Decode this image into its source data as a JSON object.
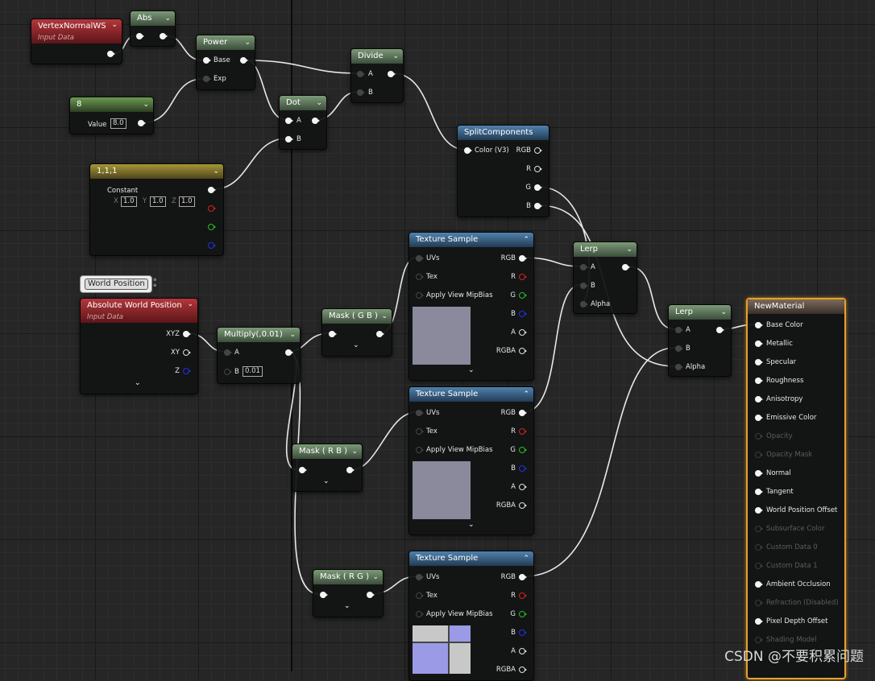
{
  "nodes": {
    "vertex_normal": {
      "title": "VertexNormalWS",
      "subtitle": "Input Data"
    },
    "abs": {
      "title": "Abs"
    },
    "power": {
      "title": "Power",
      "pin_base": "Base",
      "pin_exp": "Exp"
    },
    "const8": {
      "title": "8",
      "value_label": "Value",
      "value": "8.0"
    },
    "dot": {
      "title": "Dot",
      "pin_a": "A",
      "pin_b": "B"
    },
    "divide": {
      "title": "Divide",
      "pin_a": "A",
      "pin_b": "B"
    },
    "const111": {
      "title": "1,1,1",
      "constant_label": "Constant",
      "x_label": "X",
      "x_value": "1.0",
      "y_label": "Y",
      "y_value": "1.0",
      "z_label": "Z",
      "z_value": "1.0"
    },
    "split": {
      "title": "SplitComponents",
      "in_label": "Color (V3)",
      "out_rgb": "RGB",
      "out_r": "R",
      "out_g": "G",
      "out_b": "B"
    },
    "world_position_tag": {
      "label": "World Position"
    },
    "abs_world_pos": {
      "title": "Absolute World Position",
      "subtitle": "Input Data",
      "out_xyz": "XYZ",
      "out_xy": "XY",
      "out_z": "Z"
    },
    "multiply": {
      "title": "Multiply(,0.01)",
      "pin_a": "A",
      "pin_b": "B",
      "b_value": "0.01"
    },
    "mask_gb": {
      "title": "Mask ( G B )"
    },
    "mask_rb": {
      "title": "Mask ( R B )"
    },
    "mask_rg": {
      "title": "Mask ( R G )"
    },
    "texture_sample": {
      "title": "Texture Sample",
      "uvs": "UVs",
      "tex": "Tex",
      "mip": "Apply View MipBias",
      "rgb": "RGB",
      "r": "R",
      "g": "G",
      "b": "B",
      "a": "A",
      "rgba": "RGBA"
    },
    "lerp1": {
      "title": "Lerp",
      "pin_a": "A",
      "pin_b": "B",
      "pin_alpha": "Alpha"
    },
    "lerp2": {
      "title": "Lerp",
      "pin_a": "A",
      "pin_b": "B",
      "pin_alpha": "Alpha"
    },
    "material": {
      "title": "NewMaterial",
      "pins": [
        {
          "label": "Base Color",
          "enabled": true
        },
        {
          "label": "Metallic",
          "enabled": true
        },
        {
          "label": "Specular",
          "enabled": true
        },
        {
          "label": "Roughness",
          "enabled": true
        },
        {
          "label": "Anisotropy",
          "enabled": true
        },
        {
          "label": "Emissive Color",
          "enabled": true
        },
        {
          "label": "Opacity",
          "enabled": false
        },
        {
          "label": "Opacity Mask",
          "enabled": false
        },
        {
          "label": "Normal",
          "enabled": true
        },
        {
          "label": "Tangent",
          "enabled": true
        },
        {
          "label": "World Position Offset",
          "enabled": true
        },
        {
          "label": "Subsurface Color",
          "enabled": false
        },
        {
          "label": "Custom Data 0",
          "enabled": false
        },
        {
          "label": "Custom Data 1",
          "enabled": false
        },
        {
          "label": "Ambient Occlusion",
          "enabled": true
        },
        {
          "label": "Refraction (Disabled)",
          "enabled": false
        },
        {
          "label": "Pixel Depth Offset",
          "enabled": true
        },
        {
          "label": "Shading Model",
          "enabled": false
        }
      ]
    }
  },
  "watermark": "CSDN @不要积累问题",
  "colors": {
    "selection": "#e6a12c",
    "wire": "#e8e8e8",
    "preview_flat": "#8a8a9c",
    "preview_checker_a": "#c8c8c8",
    "preview_checker_b": "#9a9ae6"
  }
}
